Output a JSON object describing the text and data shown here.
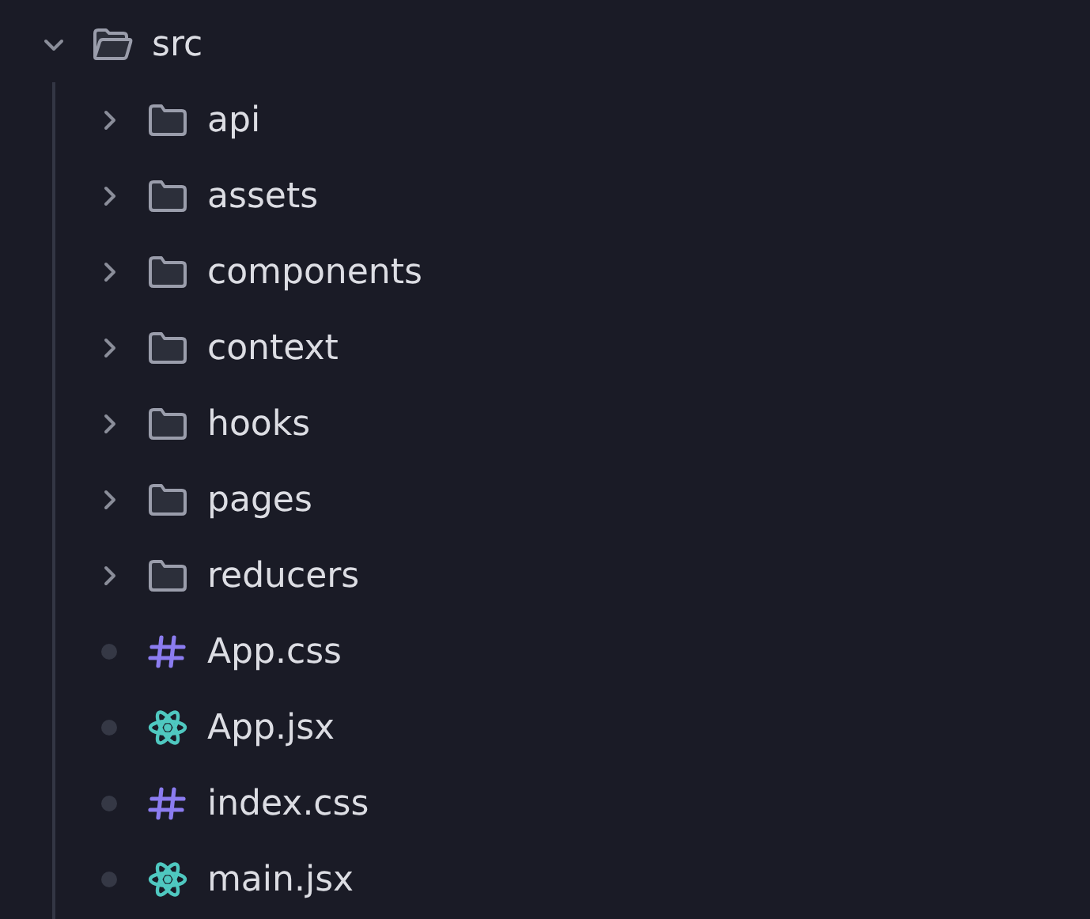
{
  "tree": [
    {
      "name": "src",
      "kind": "folder",
      "expanded": true,
      "children": [
        {
          "name": "api",
          "kind": "folder",
          "expanded": false
        },
        {
          "name": "assets",
          "kind": "folder",
          "expanded": false
        },
        {
          "name": "components",
          "kind": "folder",
          "expanded": false
        },
        {
          "name": "context",
          "kind": "folder",
          "expanded": false
        },
        {
          "name": "hooks",
          "kind": "folder",
          "expanded": false
        },
        {
          "name": "pages",
          "kind": "folder",
          "expanded": false
        },
        {
          "name": "reducers",
          "kind": "folder",
          "expanded": false
        },
        {
          "name": "App.css",
          "kind": "css"
        },
        {
          "name": "App.jsx",
          "kind": "react"
        },
        {
          "name": "index.css",
          "kind": "css"
        },
        {
          "name": "main.jsx",
          "kind": "react"
        }
      ]
    }
  ]
}
